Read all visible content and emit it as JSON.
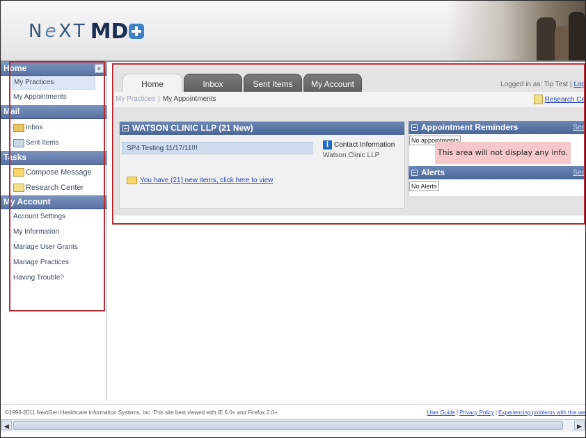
{
  "header": {
    "logo": {
      "prefix": "N",
      "accent": "e",
      "middle": "XT",
      "suffix": "MD"
    }
  },
  "sidebar": {
    "home": {
      "title": "Home",
      "collapse": "«",
      "items": [
        "My Practices",
        "My Appointments"
      ]
    },
    "mail": {
      "title": "Mail",
      "items": [
        "Inbox",
        "Sent Items"
      ]
    },
    "tasks": {
      "title": "Tasks",
      "items": [
        "Compose Message",
        "Research Center"
      ]
    },
    "account": {
      "title": "My Account",
      "items": [
        "Account Settings",
        "My Information",
        "Manage User Grants",
        "Manage Practices",
        "Having Trouble?"
      ]
    }
  },
  "main": {
    "tabs": [
      "Home",
      "Inbox",
      "Sent Items",
      "My Account"
    ],
    "logged_in_prefix": "Logged in as: Tip Test |",
    "logged_in_link": "Log",
    "breadcrumb": {
      "first": "My Practices",
      "separator": "|",
      "current": "My Appointments"
    },
    "research_link": "Research Ce",
    "practice": {
      "title": "WATSON CLINIC LLP (21 New)",
      "message": "SP4 Testing 11/17/11!!!",
      "contact_label": "Contact Information",
      "contact_name": "Watson Clinic LLP",
      "new_items_link": "You have (21) new items, click here to view"
    },
    "appointments": {
      "title": "Appointment Reminders",
      "see_all": "See",
      "empty": "No appointments"
    },
    "overlay_note": "This area will not display any info.",
    "alerts": {
      "title": "Alerts",
      "see_all": "See",
      "empty": "No Alerts"
    }
  },
  "footer": {
    "copyright": "©1996-2011 NextGen Healthcare Information Systems, Inc.  This site best viewed with IE 6.0+ and Firefox 2.0+.",
    "user_guide": "User Guide",
    "privacy": "Privacy Policy",
    "problems": "Experiencing problems with this we"
  },
  "colors": {
    "accent_red": "#b22b35",
    "nav_blue": "#5a73a3",
    "link_blue": "#2a47b0",
    "overlay_pink": "#f5c9cb"
  }
}
